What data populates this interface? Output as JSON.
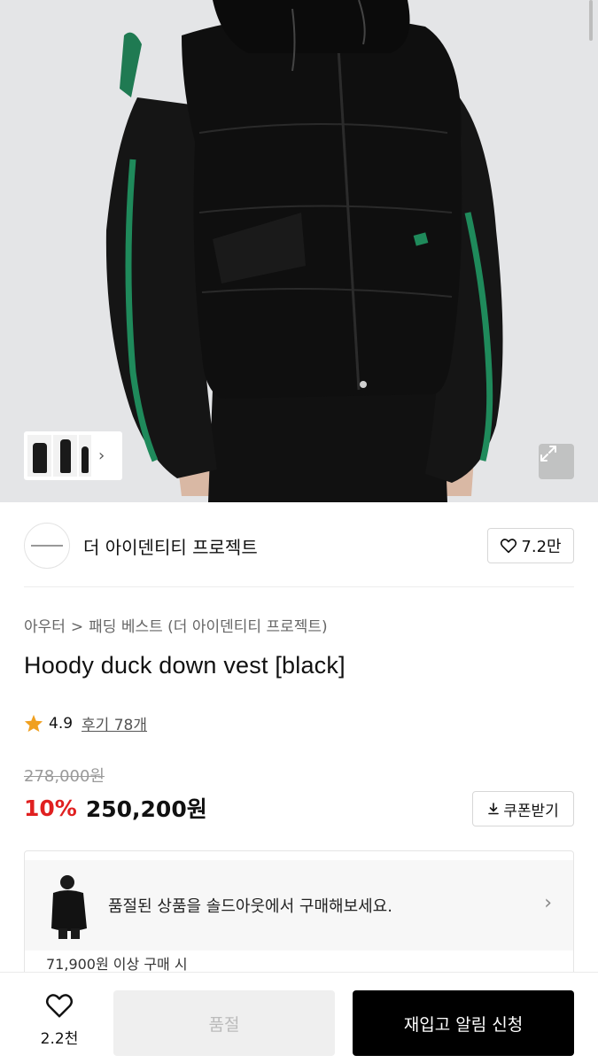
{
  "brand": {
    "name": "더 아이덴티티 프로젝트",
    "likes": "7.2만"
  },
  "breadcrumb": {
    "category": "아우터",
    "separator": ">",
    "subcategory": "패딩 베스트 (더 아이덴티티 프로젝트)"
  },
  "product": {
    "title": "Hoody duck down vest [black]",
    "rating": "4.9",
    "reviews": "후기 78개",
    "original_price": "278,000원",
    "discount": "10%",
    "price": "250,200원"
  },
  "coupon": {
    "label": "쿠폰받기"
  },
  "soldout_banner": {
    "text": "품절된 상품을 솔드아웃에서 구매해보세요.",
    "peek_text": "71,900원 이상 구매 시"
  },
  "bottom_bar": {
    "wish_count": "2.2천",
    "soldout_label": "품절",
    "restock_label": "재입고 알림 신청"
  },
  "icons": {
    "expand": "expand-icon",
    "heart": "heart-icon",
    "star": "star-icon",
    "download": "download-icon",
    "chevron": "chevron-right-icon"
  },
  "colors": {
    "discount": "#e02020",
    "star": "#f0a020",
    "accent_green": "#1f8a5b",
    "primary_button": "#000000"
  }
}
